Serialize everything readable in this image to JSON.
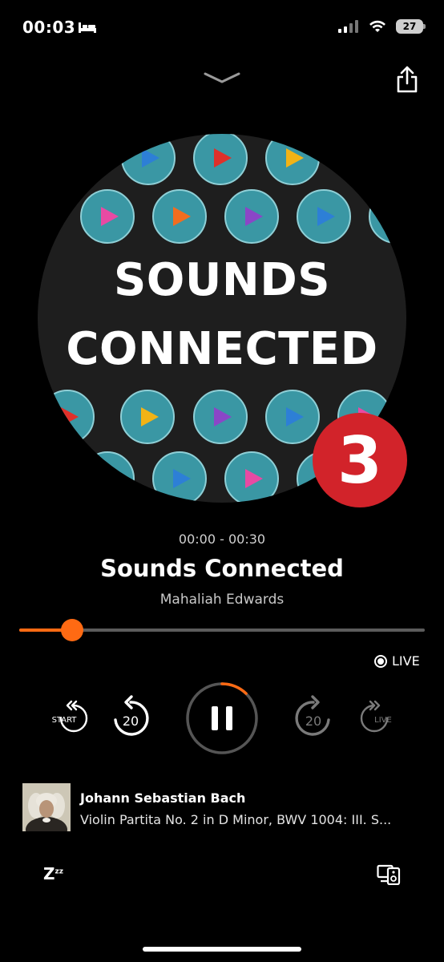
{
  "status_bar": {
    "time": "00:03",
    "battery": "27"
  },
  "artwork": {
    "title_line1": "SOUNDS",
    "title_line2": "CONNECTED",
    "station_badge": "3"
  },
  "episode": {
    "time_range": "00:00 - 00:30",
    "title": "Sounds Connected",
    "presenter": "Mahaliah Edwards",
    "progress": 0.13
  },
  "live_label": "LIVE",
  "controls": {
    "start_label": "START",
    "rewind_label": "20",
    "forward_label": "20",
    "live_label": "LIVE"
  },
  "now_playing": {
    "artist": "Johann Sebastian Bach",
    "track": "Violin Partita No. 2 in D Minor, BWV 1004: III. S..."
  },
  "sleep_label": "Z",
  "colors": {
    "accent": "#ff6a13",
    "radio3_red": "#d2232a",
    "tile_teal": "#3a97a4"
  }
}
